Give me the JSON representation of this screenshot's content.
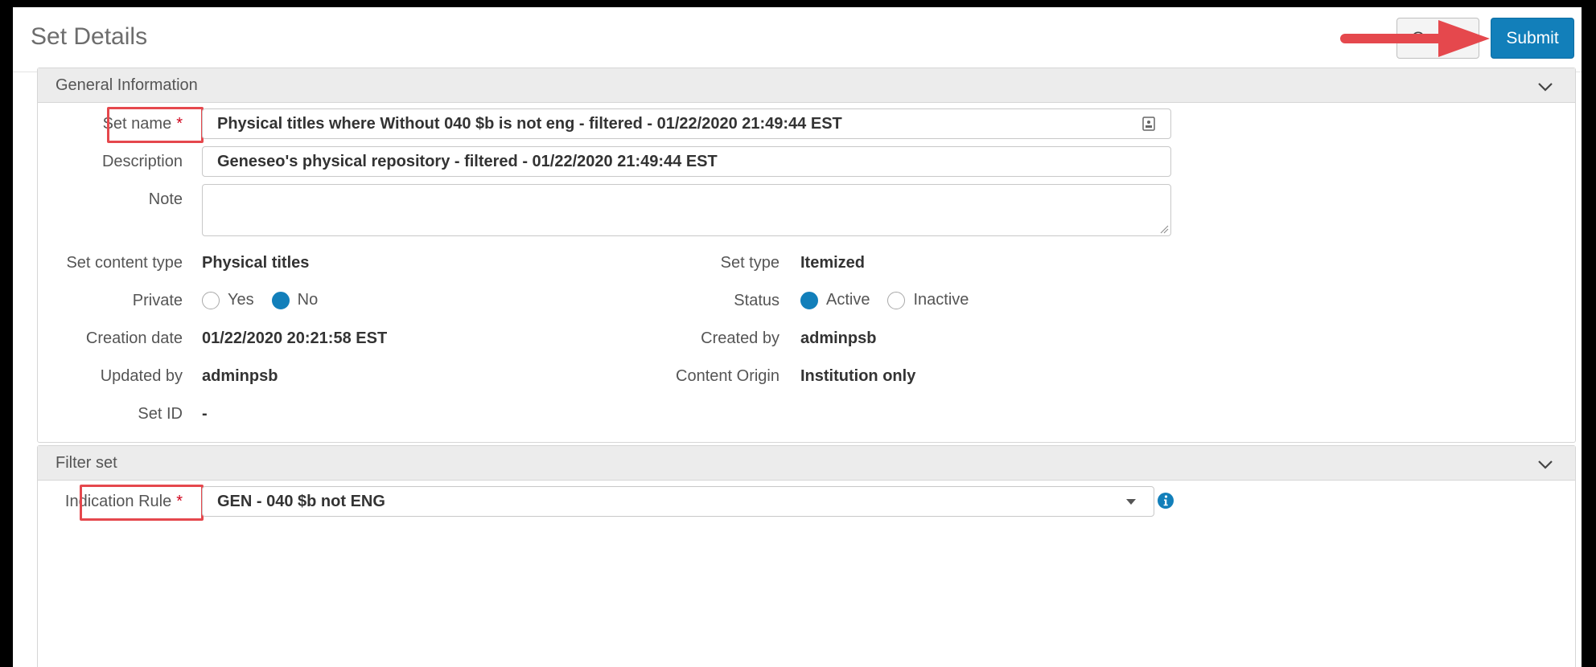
{
  "header": {
    "title": "Set Details",
    "cancel_label": "Cancel",
    "submit_label": "Submit"
  },
  "general": {
    "title": "General Information",
    "set_name": {
      "label": "Set name",
      "required_mark": "*",
      "value": "Physical titles where Without 040 $b is not eng - filtered - 01/22/2020 21:49:44 EST"
    },
    "description": {
      "label": "Description",
      "value": "Geneseo's physical repository - filtered - 01/22/2020 21:49:44 EST"
    },
    "note": {
      "label": "Note",
      "value": ""
    },
    "set_content_type": {
      "label": "Set content type",
      "value": "Physical titles"
    },
    "set_type": {
      "label": "Set type",
      "value": "Itemized"
    },
    "private": {
      "label": "Private",
      "options": [
        "Yes",
        "No"
      ],
      "selected": "No"
    },
    "status": {
      "label": "Status",
      "options": [
        "Active",
        "Inactive"
      ],
      "selected": "Active"
    },
    "creation_date": {
      "label": "Creation date",
      "value": "01/22/2020 20:21:58 EST"
    },
    "created_by": {
      "label": "Created by",
      "value": "adminpsb"
    },
    "updated_by": {
      "label": "Updated by",
      "value": "adminpsb"
    },
    "content_origin": {
      "label": "Content Origin",
      "value": "Institution only"
    },
    "set_id": {
      "label": "Set ID",
      "value": "-"
    }
  },
  "filter": {
    "title": "Filter set",
    "indication_rule": {
      "label": "Indication Rule",
      "required_mark": "*",
      "value": "GEN - 040 $b not ENG"
    }
  },
  "colors": {
    "accent": "#127fba",
    "highlight": "#e5484d",
    "required": "#d0021b"
  }
}
